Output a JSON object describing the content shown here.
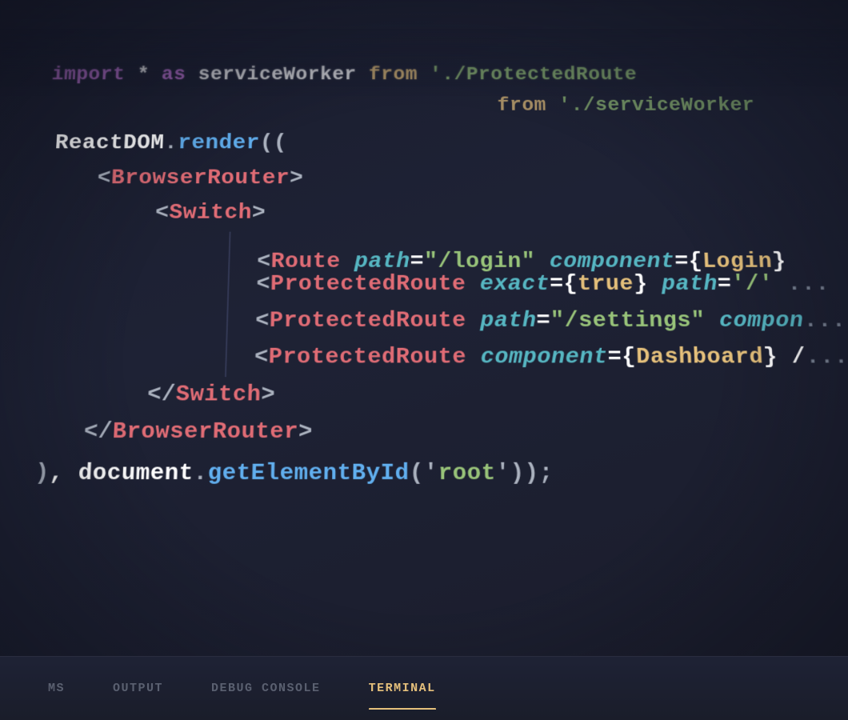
{
  "editor": {
    "background": "#1e2030",
    "lines": [
      {
        "id": "line-import-1",
        "blur": true,
        "parts": [
          {
            "text": "import",
            "color": "keyword"
          },
          {
            "text": " * ",
            "color": "white"
          },
          {
            "text": "as",
            "color": "keyword"
          },
          {
            "text": " serviceWorker ",
            "color": "white"
          },
          {
            "text": "from",
            "color": "from"
          },
          {
            "text": " '",
            "color": "white"
          },
          {
            "text": "./ProtectedRoute",
            "color": "path"
          },
          {
            "text": "'",
            "color": "white"
          }
        ]
      },
      {
        "id": "line-import-2",
        "blur": true,
        "parts": [
          {
            "text": "from",
            "color": "from"
          },
          {
            "text": " '",
            "color": "white"
          },
          {
            "text": "./serviceWorker",
            "color": "path"
          },
          {
            "text": "'",
            "color": "white"
          }
        ]
      },
      {
        "id": "line-reactdom",
        "parts": [
          {
            "text": "ReactDOM",
            "color": "white"
          },
          {
            "text": ".",
            "color": "dot"
          },
          {
            "text": "render",
            "color": "func"
          },
          {
            "text": "((",
            "color": "bracket"
          }
        ]
      },
      {
        "id": "line-browserrouter-open",
        "indent": 1,
        "parts": [
          {
            "text": "<",
            "color": "jsx-bracket"
          },
          {
            "text": "BrowserRouter",
            "color": "tag"
          },
          {
            "text": ">",
            "color": "jsx-bracket"
          }
        ]
      },
      {
        "id": "line-switch-open",
        "indent": 2,
        "parts": [
          {
            "text": "<",
            "color": "jsx-bracket"
          },
          {
            "text": "Switch",
            "color": "tag"
          },
          {
            "text": ">",
            "color": "jsx-bracket"
          }
        ]
      },
      {
        "id": "line-route",
        "indent": 3,
        "parts": [
          {
            "text": "<",
            "color": "jsx-bracket"
          },
          {
            "text": "Route",
            "color": "tag"
          },
          {
            "text": " ",
            "color": "white"
          },
          {
            "text": "path",
            "color": "attr"
          },
          {
            "text": "=",
            "color": "white"
          },
          {
            "text": "\"/login\"",
            "color": "string"
          },
          {
            "text": " ",
            "color": "white"
          },
          {
            "text": "component",
            "color": "attr"
          },
          {
            "text": "={",
            "color": "white"
          },
          {
            "text": "Login",
            "color": "val"
          },
          {
            "text": "}",
            "color": "white"
          }
        ]
      },
      {
        "id": "line-protected-1",
        "indent": 3,
        "parts": [
          {
            "text": "<",
            "color": "jsx-bracket"
          },
          {
            "text": "ProtectedRoute",
            "color": "tag"
          },
          {
            "text": " ",
            "color": "white"
          },
          {
            "text": "exact",
            "color": "attr"
          },
          {
            "text": "={",
            "color": "white"
          },
          {
            "text": "true",
            "color": "val"
          },
          {
            "text": "} ",
            "color": "white"
          },
          {
            "text": "path",
            "color": "attr"
          },
          {
            "text": "=",
            "color": "white"
          },
          {
            "text": "'/'",
            "color": "string"
          },
          {
            "text": " ...",
            "color": "comment"
          }
        ]
      },
      {
        "id": "line-protected-2",
        "indent": 3,
        "parts": [
          {
            "text": "<",
            "color": "jsx-bracket"
          },
          {
            "text": "ProtectedRoute",
            "color": "tag"
          },
          {
            "text": " ",
            "color": "white"
          },
          {
            "text": "path",
            "color": "attr"
          },
          {
            "text": "=",
            "color": "white"
          },
          {
            "text": "\"/settings\"",
            "color": "string"
          },
          {
            "text": " ",
            "color": "white"
          },
          {
            "text": "compon",
            "color": "attr"
          },
          {
            "text": "...",
            "color": "comment"
          }
        ]
      },
      {
        "id": "line-protected-3",
        "indent": 3,
        "parts": [
          {
            "text": "<",
            "color": "jsx-bracket"
          },
          {
            "text": "ProtectedRoute",
            "color": "tag"
          },
          {
            "text": " ",
            "color": "white"
          },
          {
            "text": "component",
            "color": "attr"
          },
          {
            "text": "={",
            "color": "white"
          },
          {
            "text": "Dashboard",
            "color": "val"
          },
          {
            "text": "} /",
            "color": "white"
          },
          {
            "text": "...",
            "color": "comment"
          }
        ]
      },
      {
        "id": "line-switch-close",
        "indent": 2,
        "parts": [
          {
            "text": "</",
            "color": "jsx-bracket"
          },
          {
            "text": "Switch",
            "color": "tag"
          },
          {
            "text": ">",
            "color": "jsx-bracket"
          }
        ]
      },
      {
        "id": "line-browserrouter-close",
        "indent": 1,
        "parts": [
          {
            "text": "</",
            "color": "jsx-bracket"
          },
          {
            "text": "BrowserRouter",
            "color": "tag"
          },
          {
            "text": ">",
            "color": "jsx-bracket"
          }
        ]
      },
      {
        "id": "line-document",
        "parts": [
          {
            "text": ")",
            "color": "bracket"
          },
          {
            "text": ", ",
            "color": "white"
          },
          {
            "text": "document",
            "color": "white"
          },
          {
            "text": ".",
            "color": "dot"
          },
          {
            "text": "getElementById",
            "color": "func"
          },
          {
            "text": "('",
            "color": "bracket"
          },
          {
            "text": "root",
            "color": "string"
          },
          {
            "text": "'));",
            "color": "bracket"
          }
        ]
      }
    ]
  },
  "bottom_panel": {
    "tabs": [
      {
        "id": "tab-ms",
        "label": "MS",
        "active": false
      },
      {
        "id": "tab-output",
        "label": "OUTPUT",
        "active": false
      },
      {
        "id": "tab-debug",
        "label": "DEBUG CONSOLE",
        "active": false
      },
      {
        "id": "tab-terminal",
        "label": "TERMINAL",
        "active": true
      }
    ]
  }
}
